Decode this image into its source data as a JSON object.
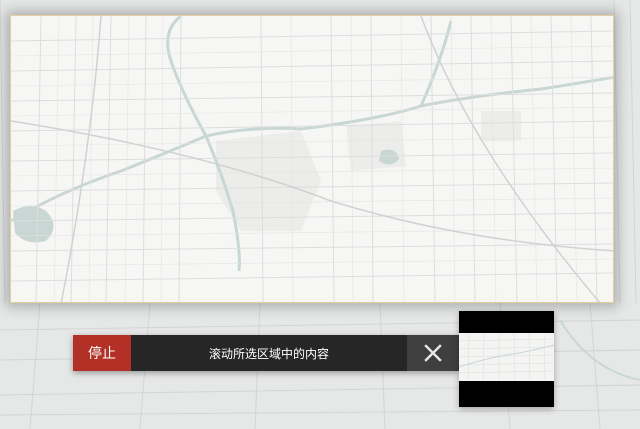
{
  "capture": {
    "stop_label": "停止",
    "hint_text": "滚动所选区域中的内容",
    "close_icon": "close-icon"
  },
  "colors": {
    "stop_bg": "#b23026",
    "bar_bg": "#262626",
    "close_bg": "#3f3f3f",
    "selection_border": "#e2cf9c",
    "map_land": "#f4f4f3",
    "map_water": "#c9d7d4"
  }
}
